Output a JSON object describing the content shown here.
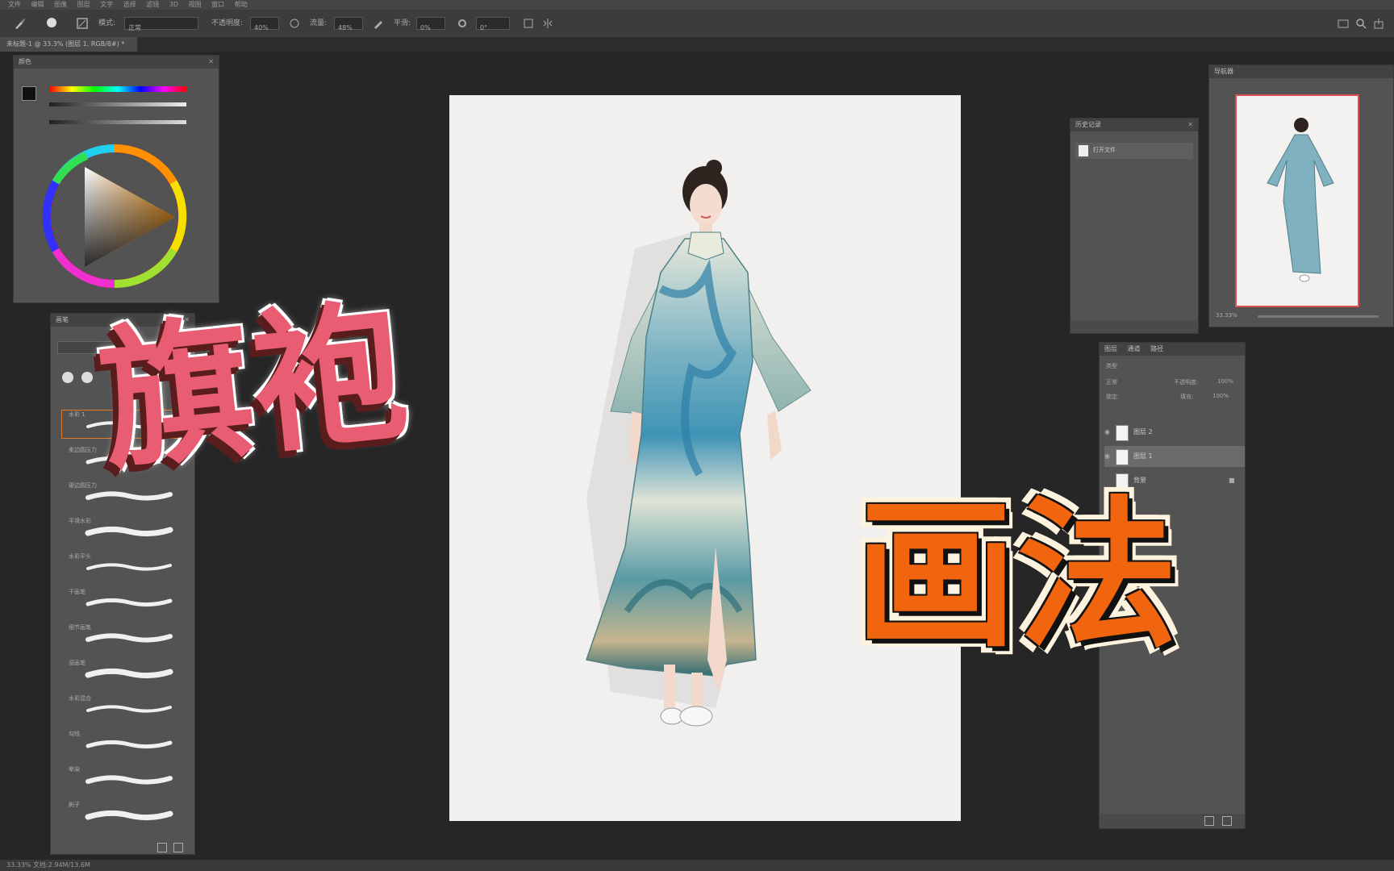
{
  "menubar": {
    "items": [
      "文件",
      "编辑",
      "图像",
      "图层",
      "文字",
      "选择",
      "滤镜",
      "3D",
      "视图",
      "窗口",
      "帮助"
    ]
  },
  "options_bar": {
    "mode_label": "模式:",
    "mode_value": "正常",
    "opacity_label": "不透明度:",
    "opacity_value": "40%",
    "flow_label": "流量:",
    "flow_value": "48%",
    "smooth_label": "平滑:",
    "smooth_value": "0%",
    "angle_value": "0°"
  },
  "document_tab": {
    "title": "未标题-1 @ 33.3% (图层 1, RGB/8#) *"
  },
  "color_panel": {
    "title": "颜色"
  },
  "brush_panel": {
    "title": "画笔",
    "brushes": [
      "水彩 1",
      "柔边圆压力",
      "硬边圆压力",
      "平滑水彩",
      "水彩平头",
      "干画笔",
      "细节画笔",
      "湿画笔",
      "水彩混合",
      "勾线",
      "晕染",
      "刷子"
    ]
  },
  "history_panel": {
    "title": "历史记录",
    "item": "打开文件"
  },
  "navigator_panel": {
    "title": "导航器",
    "zoom": "33.33%"
  },
  "layers_panel": {
    "tabs": [
      "图层",
      "通道",
      "路径"
    ],
    "kind_label": "类型",
    "blend": "正常",
    "opacity_label": "不透明度:",
    "opacity_value": "100%",
    "lock_label": "锁定:",
    "fill_label": "填充:",
    "fill_value": "100%",
    "layers": [
      {
        "name": "图层 2",
        "selected": false
      },
      {
        "name": "图层 1",
        "selected": true
      },
      {
        "name": "背景",
        "selected": false
      }
    ]
  },
  "overlay_titles": {
    "qipao": "旗袍",
    "huafa": "画法"
  },
  "status": {
    "text": "33.33%   文档:2.94M/13.6M"
  },
  "colors": {
    "title_pink": "#e85d72",
    "title_orange": "#f2650f",
    "dress_teal": "#5a9eb0",
    "dress_cream": "#e9eadb"
  },
  "icons": [
    "brush-icon",
    "gear-icon",
    "close-icon",
    "eye-icon",
    "lock-icon",
    "trash-icon",
    "new-layer-icon",
    "search-icon"
  ]
}
